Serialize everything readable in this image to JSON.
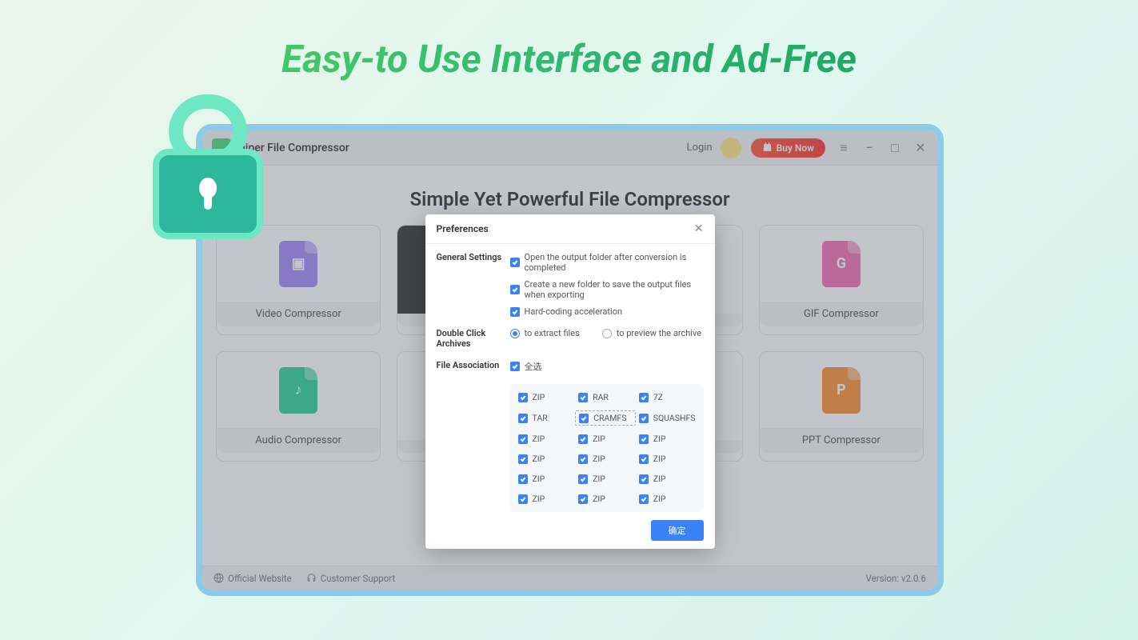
{
  "banner": {
    "title": "Easy-to Use Interface and Ad-Free"
  },
  "titlebar": {
    "app_name": "hiper File Compressor",
    "login_label": "Login",
    "buy_label": "Buy Now"
  },
  "main": {
    "heading": "Simple Yet Powerful File Compressor",
    "cards": [
      {
        "label": "Video Compressor",
        "glyph": "▣"
      },
      {
        "label": "",
        "glyph": ""
      },
      {
        "label": "",
        "glyph": ""
      },
      {
        "label": "GIF Compressor",
        "glyph": "G"
      },
      {
        "label": "Audio Compressor",
        "glyph": "♪"
      },
      {
        "label": "",
        "glyph": ""
      },
      {
        "label": "",
        "glyph": ""
      },
      {
        "label": "PPT Compressor",
        "glyph": "P"
      }
    ]
  },
  "modal": {
    "title": "Preferences",
    "sections": {
      "general": {
        "label": "General Settings",
        "items": [
          "Open the output folder after conversion is completed",
          "Create a new folder to save the output files when exporting",
          "Hard-coding acceleration"
        ]
      },
      "doubleclick": {
        "label": "Double Click Archives",
        "opt1": "to extract files",
        "opt2": "to preview the archive"
      },
      "assoc": {
        "label": "File Association",
        "select_all": "全选",
        "items": [
          "ZIP",
          "RAR",
          "7Z",
          "TAR",
          "CRAMFS",
          "SQUASHFS",
          "ZIP",
          "ZIP",
          "ZIP",
          "ZIP",
          "ZIP",
          "ZIP",
          "ZIP",
          "ZIP",
          "ZIP",
          "ZIP",
          "ZIP",
          "ZIP"
        ]
      }
    },
    "confirm": "确定"
  },
  "statusbar": {
    "website": "Official Website",
    "support": "Customer Support",
    "version": "Version: v2.0.6"
  }
}
